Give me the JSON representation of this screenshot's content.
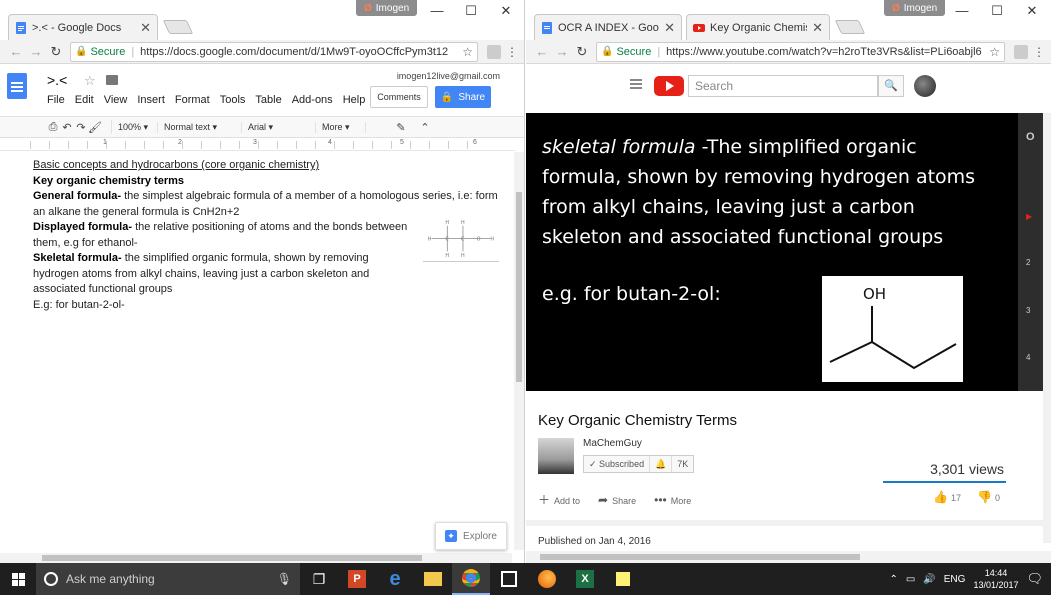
{
  "left_window": {
    "tabs": [
      {
        "label": ">.< - Google Docs"
      }
    ],
    "imogen_label": "Imogen",
    "address": {
      "secure": "Secure",
      "url": "https://docs.google.com/document/d/1Mw9T-oyoOCffcPym3t12"
    },
    "docs": {
      "title": ">.<",
      "email": "imogen12live@gmail.com",
      "menu": [
        "File",
        "Edit",
        "View",
        "Insert",
        "Format",
        "Tools",
        "Table",
        "Add-ons",
        "Help"
      ],
      "comments_label": "Comments",
      "share_label": "Share",
      "toolbar": {
        "zoom": "100%",
        "style": "Normal text",
        "font": "Arial",
        "more": "More"
      },
      "ruler_numbers": [
        "1",
        "2",
        "3",
        "4",
        "5",
        "6"
      ],
      "content": {
        "heading_underline": "Basic concepts and hydrocarbons (core organic chemistry)",
        "heading_bold": "Key organic chemistry terms",
        "p1_term": "General formula-",
        "p1_text": " the simplest algebraic formula of a member of a homologous series, i.e: form an alkane the general formula is CnH2n+2",
        "p2_term": "Displayed formula-",
        "p2_text": " the relative positioning of atoms and the bonds between them, e.g for ethanol-",
        "p3_term": "Skeletal formula-",
        "p3_text": " the simplified organic formula, shown by removing hydrogen atoms from alkyl chains, leaving just a carbon skeleton and associated functional groups",
        "p4_text": "E.g: for butan-2-ol-"
      },
      "explore_label": "Explore"
    }
  },
  "right_window": {
    "tabs": [
      {
        "label": "OCR A INDEX - Google D"
      },
      {
        "label": "Key Organic Chemistry Te"
      }
    ],
    "imogen_label": "Imogen",
    "address": {
      "secure": "Secure",
      "url": "https://www.youtube.com/watch?v=h2roTte3VRs&list=PLi6oabjl6"
    },
    "youtube": {
      "search_placeholder": "Search",
      "video_lines": [
        {
          "italic": "skeletal formula",
          "rest": " -The simplified organic"
        },
        {
          "italic": "",
          "rest": "formula, shown by removing hydrogen atoms"
        },
        {
          "italic": "",
          "rest": "from alkyl chains, leaving just a carbon"
        },
        {
          "italic": "",
          "rest": "skeleton and associated functional groups"
        }
      ],
      "video_eg": "e.g. for butan-2-ol:",
      "molecule_label": "OH",
      "side_numbers": [
        "2",
        "3",
        "4"
      ],
      "video_title": "Key Organic Chemistry Terms",
      "channel": "MaChemGuy",
      "subscribed_label": "Subscribed",
      "subscriber_count": "7K",
      "views": "3,301 views",
      "actions": {
        "add_to": "Add to",
        "share": "Share",
        "more": "More"
      },
      "likes": "17",
      "dislikes": "0",
      "published": "Published on Jan 4, 2016"
    }
  },
  "taskbar": {
    "search_placeholder": "Ask me anything",
    "language": "ENG",
    "time": "14:44",
    "date": "13/01/2017"
  }
}
